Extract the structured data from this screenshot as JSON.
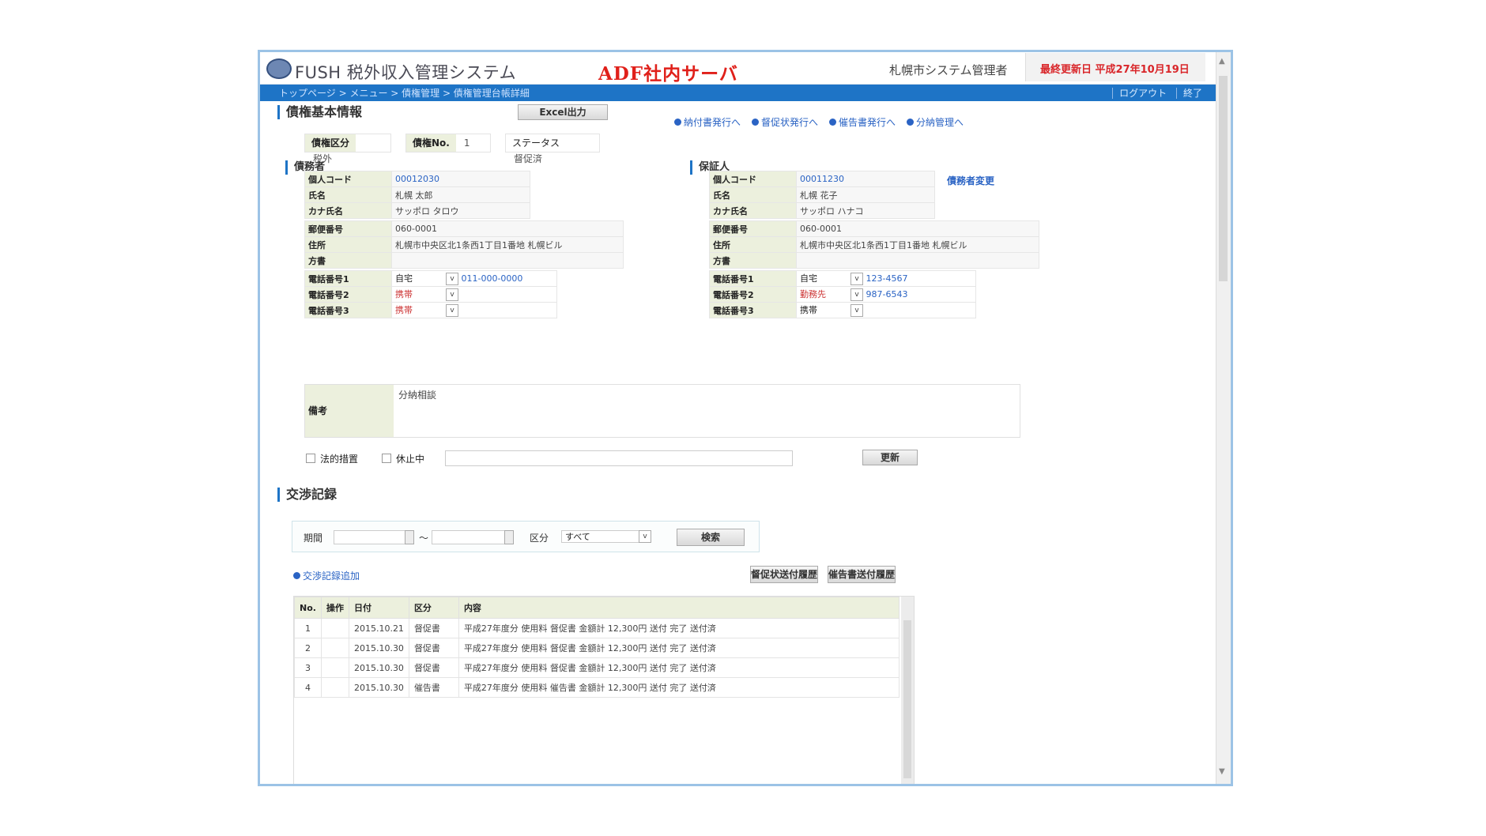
{
  "titlebar": {
    "app_title": "FUSH 税外収入管理システム",
    "server_label": "ADF社内サーバ",
    "user_label": "札幌市システム管理者",
    "notice": "最終更新日 平成27年10月19日"
  },
  "navbar": {
    "breadcrumb": "トップページ > メニュー > 債権管理 > 債権管理台帳詳細",
    "links": [
      "ログアウト",
      "終了"
    ]
  },
  "colors": {
    "accent": "#1e74c6",
    "danger": "#e0201a",
    "label_bg": "#ecf0dd"
  },
  "claim": {
    "title": "債権基本情報",
    "excel_button": "Excel出力",
    "links": [
      "納付書発行へ",
      "督促状発行へ",
      "催告書発行へ",
      "分納管理へ"
    ],
    "chips": [
      {
        "key": "債権区分",
        "value": "税外"
      },
      {
        "key": "債権No.",
        "value": "1"
      },
      {
        "key": "ステータス",
        "value": "督促済"
      }
    ]
  },
  "debtor": {
    "title": "債務者",
    "rows": [
      {
        "key": "個人コード",
        "value": "00012030"
      },
      {
        "key": "氏名",
        "value": "札幌 太郎"
      },
      {
        "key": "カナ氏名",
        "value": "サッポロ タロウ"
      },
      {
        "key": "郵便番号",
        "value": "060-0001"
      },
      {
        "key": "住所",
        "value": "札幌市中央区北1条西1丁目1番地 札幌ビル"
      },
      {
        "key": "方書",
        "value": ""
      }
    ],
    "phones": [
      {
        "key": "電話番号1",
        "type": "自宅",
        "value": "011-000-0000"
      },
      {
        "key": "電話番号2",
        "type": "携帯",
        "value": ""
      },
      {
        "key": "電話番号3",
        "type": "携帯",
        "value": ""
      }
    ]
  },
  "guarantor": {
    "title": "保証人",
    "link": "債務者変更",
    "rows": [
      {
        "key": "個人コード",
        "value": "00011230"
      },
      {
        "key": "氏名",
        "value": "札幌 花子"
      },
      {
        "key": "カナ氏名",
        "value": "サッポロ ハナコ"
      },
      {
        "key": "郵便番号",
        "value": "060-0001"
      },
      {
        "key": "住所",
        "value": "札幌市中央区北1条西1丁目1番地 札幌ビル"
      },
      {
        "key": "方書",
        "value": ""
      }
    ],
    "phones": [
      {
        "key": "電話番号1",
        "type": "自宅",
        "value": "123-4567"
      },
      {
        "key": "電話番号2",
        "type": "勤務先",
        "value": "987-6543"
      },
      {
        "key": "電話番号3",
        "type": "携帯",
        "value": ""
      }
    ]
  },
  "note": {
    "label": "備考",
    "value": "分納相談"
  },
  "options": {
    "checks": [
      "法的措置",
      "休止中"
    ],
    "update_button": "更新"
  },
  "history": {
    "title": "交渉記録",
    "filter": {
      "period_label": "期間",
      "separator": "～",
      "kind_label": "区分",
      "kind_value": "すべて",
      "search_button": "検索"
    },
    "add_link": "交渉記録追加",
    "buttons": [
      "督促状送付履歴",
      "催告書送付履歴"
    ],
    "columns": [
      "No.",
      "操作",
      "日付",
      "区分",
      "内容"
    ],
    "rows": [
      {
        "no": "1",
        "op": "",
        "date": "2015.10.21",
        "kind": "督促書",
        "content": "平成27年度分 使用料 督促書 金額計 12,300円 送付 完了 送付済"
      },
      {
        "no": "2",
        "op": "",
        "date": "2015.10.30",
        "kind": "督促書",
        "content": "平成27年度分 使用料 督促書 金額計 12,300円 送付 完了 送付済"
      },
      {
        "no": "3",
        "op": "",
        "date": "2015.10.30",
        "kind": "督促書",
        "content": "平成27年度分 使用料 督促書 金額計 12,300円 送付 完了 送付済"
      },
      {
        "no": "4",
        "op": "",
        "date": "2015.10.30",
        "kind": "催告書",
        "content": "平成27年度分 使用料 催告書 金額計 12,300円 送付 完了 送付済"
      }
    ]
  }
}
